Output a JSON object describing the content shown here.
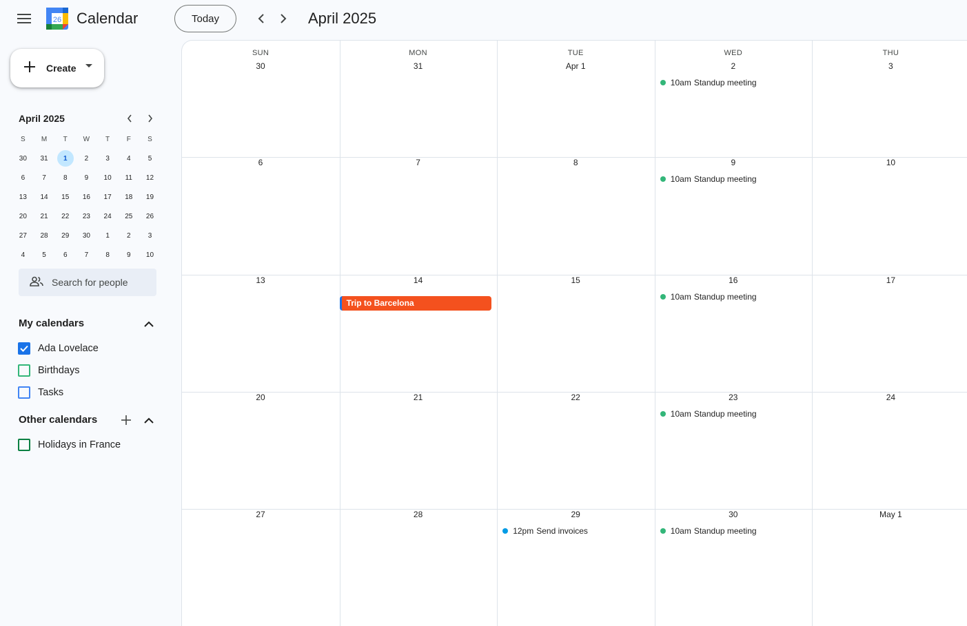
{
  "header": {
    "app_title": "Calendar",
    "logo_day": "26",
    "today_label": "Today",
    "period_title": "April 2025"
  },
  "sidebar": {
    "create_label": "Create",
    "mini_calendar": {
      "title": "April 2025",
      "weekday_heads": [
        "S",
        "M",
        "T",
        "W",
        "T",
        "F",
        "S"
      ],
      "weeks": [
        [
          "30",
          "31",
          "1",
          "2",
          "3",
          "4",
          "5"
        ],
        [
          "6",
          "7",
          "8",
          "9",
          "10",
          "11",
          "12"
        ],
        [
          "13",
          "14",
          "15",
          "16",
          "17",
          "18",
          "19"
        ],
        [
          "20",
          "21",
          "22",
          "23",
          "24",
          "25",
          "26"
        ],
        [
          "27",
          "28",
          "29",
          "30",
          "1",
          "2",
          "3"
        ],
        [
          "4",
          "5",
          "6",
          "7",
          "8",
          "9",
          "10"
        ]
      ],
      "selected": "1"
    },
    "people_search_placeholder": "Search for people",
    "my_calendars": {
      "heading": "My calendars",
      "items": [
        {
          "label": "Ada Lovelace",
          "checked": true,
          "color": "#1a73e8"
        },
        {
          "label": "Birthdays",
          "checked": false,
          "color": "#33b679"
        },
        {
          "label": "Tasks",
          "checked": false,
          "color": "#4285f4"
        }
      ]
    },
    "other_calendars": {
      "heading": "Other calendars",
      "items": [
        {
          "label": "Holidays in France",
          "checked": false,
          "color": "#0b8043"
        }
      ]
    }
  },
  "month_grid": {
    "weekdays": [
      "SUN",
      "MON",
      "TUE",
      "WED",
      "THU"
    ],
    "weeks": [
      {
        "days": [
          "30",
          "31",
          "Apr 1",
          "2",
          "3"
        ]
      },
      {
        "days": [
          "6",
          "7",
          "8",
          "9",
          "10"
        ]
      },
      {
        "days": [
          "13",
          "14",
          "15",
          "16",
          "17"
        ]
      },
      {
        "days": [
          "20",
          "21",
          "22",
          "23",
          "24"
        ]
      },
      {
        "days": [
          "27",
          "28",
          "29",
          "30",
          "May 1"
        ]
      }
    ],
    "timed_events": [
      {
        "week": 0,
        "col": 3,
        "time": "10am",
        "title": "Standup meeting",
        "color": "#33b679"
      },
      {
        "week": 1,
        "col": 3,
        "time": "10am",
        "title": "Standup meeting",
        "color": "#33b679"
      },
      {
        "week": 2,
        "col": 3,
        "time": "10am",
        "title": "Standup meeting",
        "color": "#33b679"
      },
      {
        "week": 3,
        "col": 3,
        "time": "10am",
        "title": "Standup meeting",
        "color": "#33b679"
      },
      {
        "week": 4,
        "col": 3,
        "time": "10am",
        "title": "Standup meeting",
        "color": "#33b679"
      },
      {
        "week": 4,
        "col": 2,
        "time": "12pm",
        "title": "Send invoices",
        "color": "#039be5"
      }
    ],
    "allday_events": [
      {
        "week": 2,
        "col": 1,
        "title": "Trip to Barcelona",
        "color": "#f4511e"
      }
    ]
  }
}
